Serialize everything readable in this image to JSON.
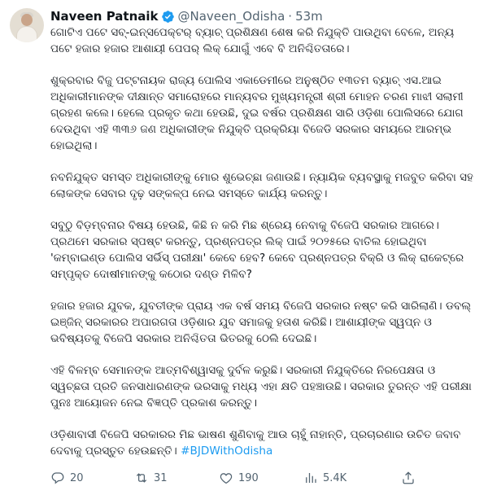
{
  "author": {
    "name": "Naveen Patnaik",
    "handle": "@Naveen_Odisha",
    "separator": "·",
    "time": "53m"
  },
  "paragraphs": [
    "ଗୋଟିଏ ପଟେ ସବ୍-ଇନ୍ସପେକ୍ଟର୍ ବ୍ୟାଚ୍ ପ୍ରଶିକ୍ଷଣ ଶେଷ କରି ନିଯୁକ୍ତି ପାଉଥିବା ବେଳେ, ଅନ୍ୟ ପଟେ ହଜାର ହଜାର ଆଶାୟୀ ପେପର୍ ଲିକ୍ ଯୋଗୁଁ ଏବେ ବି ଅନିଶ୍ଚିତତାରେ।",
    "ଶୁକ୍ରବାର ବିଜୁ ପଟ୍ଟନାୟକ ରାଜ୍ୟ ପୋଲିସ ଏକାଡେମୀରେ ଅନୁଷ୍ଠିତ ୧୩ତମ ବ୍ୟାଚ୍ ଏସ.ଆଇ ଅଧିକାରୀମାନଙ୍କ ଦୀକ୍ଷାନ୍ତ ସମାରୋହରେ ମାନ୍ୟବର ମୁଖ୍ୟମନ୍ତ୍ରୀ ଶ୍ରୀ ମୋହନ ଚରଣ ମାଝୀ ସଲାମୀ ଗ୍ରହଣ କଲେ। ହେଲେ ପ୍ରକୃତ କଥା ହେଉଛି, ଦୁଇ ବର୍ଷର ପ୍ରଶିକ୍ଷଣ ସାରି ଓଡ଼ିଶା ପୋଲିସରେ ଯୋଗ ଦେଉଥିବା ଏହି ୩୩୬ ଜଣ ଅଧିକାରୀଙ୍କ ନିଯୁକ୍ତି ପ୍ରକ୍ରିୟା ବିଜେଡି ସରକାର ସମୟରେ ଆରମ୍ଭ ହୋଇଥିଲା।",
    "ନବନିଯୁକ୍ତ ସମସ୍ତ ଅଧିକାରୀଙ୍କୁ ମୋର ଶୁଭେଚ୍ଛା ଜଣାଉଛି। ନ୍ୟାୟିକ ବ୍ୟବସ୍ଥାକୁ ମଜବୁତ କରିବା ସହ ଲୋକଙ୍କ ସେବାର ଦୃଢ଼ ସଙ୍କଳ୍ପ ନେଇ ସମସ୍ତେ କାର୍ଯ୍ୟ କରନ୍ତୁ।",
    "ସବୁଠୁ ବିଡ଼ମ୍ବନାର ବିଷୟ ହେଉଛି, କିଛି ନ କରି ମିଛ ଶ୍ରେୟ ନେବାକୁ ବିଜେପି ସରକାର ଆଗରେ। ପ୍ରଥମେ ସରକାର ସ୍ପଷ୍ଟ କରନ୍ତୁ, ପ୍ରଶ୍ନପତ୍ର ଲିକ୍ ପାଇଁ ୨୦୨୫ରେ ବାତିଲ ହୋଇଥିବା 'କମ୍ବାଇଣ୍ଡ ପୋଲିସ ସର୍ଭିସ୍ ପରୀକ୍ଷା' କେବେ ହେବ? କେବେ ପ୍ରଶ୍ନପତ୍ର ବିକ୍ରି ଓ ଲିକ୍ ରାକେଟ୍‌ରେ ସମ୍ପୃକ୍ତ ଦୋଷୀମାନଙ୍କୁ କଠୋର ଦଣ୍ଡ ମିଳିବ?",
    "ହଜାର ହଜାର ଯୁବକ, ଯୁବତୀଙ୍କ ପ୍ରାୟ ଏକ ବର୍ଷ ସମୟ ବିଜେପି ସରକାର ନଷ୍ଟ କରି ସାରିଲାଣି। ଡବଲ୍ ଇଞ୍ଜିନ୍ ସରକାରର ଅପାରଗତା ଓଡ଼ିଶାର ଯୁବ ସମାଜକୁ ହତାଶ କରିଛି। ଆଶାୟୀଙ୍କ ସ୍ୱପ୍ନ ଓ ଭବିଷ୍ୟତକୁ ବିଜେପି ସରକାର ଅନିଶ୍ଚିତତା ଭିତରକୁ ଠେଲି ଦେଇଛି।",
    "ଏହି ବିଳମ୍ବ ସେମାନଙ୍କ ଆତ୍ମବିଶ୍ୱାସକୁ ଦୁର୍ବଳ କରୁଛି। ସରକାରୀ ନିଯୁକ୍ତିରେ ନିରପେକ୍ଷତା ଓ ସ୍ୱଚ୍ଛତା ପ୍ରତି ଜନସାଧାରଣଙ୍କ ଭରସାକୁ ମଧ୍ୟ ଏହା କ୍ଷତି ପହଞ୍ଚାଉଛି। ସରକାର ତୁରନ୍ତ ଏହି ପରୀକ୍ଷା ପୁନଃ ଆୟୋଜନ ନେଇ ବିଜ୍ଞପ୍ତି ପ୍ରକାଶ କରନ୍ତୁ।",
    "ଓଡ଼ିଶାବାସୀ ବିଜେପି ସରକାରର ମିଛ ଭାଷଣ ଶୁଣିବାକୁ ଆଉ ଚାହୁଁ ନାହାନ୍ତି, ପ୍ରଚାରଣାର ଉଚିତ ଜବାବ ଦେବାକୁ ପ୍ରସ୍ତୁତ ହେଉଛନ୍ତି।"
  ],
  "hashtag": "#BJDWithOdisha",
  "metrics": {
    "replies": "20",
    "reposts": "31",
    "likes": "190",
    "views": "5.4K"
  },
  "icons": {
    "verified": "verified-badge-icon",
    "reply": "reply-icon",
    "repost": "repost-icon",
    "like": "heart-icon",
    "views": "views-chart-icon",
    "share": "share-icon"
  },
  "colors": {
    "accent": "#1d9bf0",
    "text": "#0f1419",
    "muted": "#536471"
  }
}
